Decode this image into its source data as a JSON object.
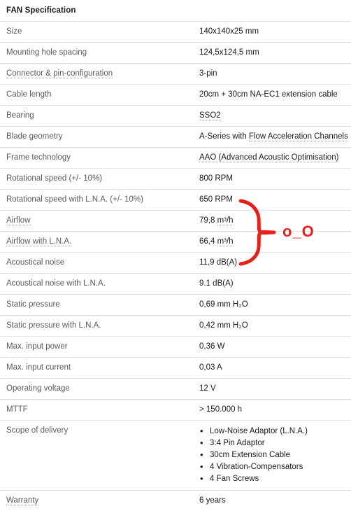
{
  "panel": {
    "title": "FAN Specification"
  },
  "rows": [
    {
      "label": "Size",
      "label_underline": "none",
      "value": "140x140x25 mm",
      "value_underline": "none"
    },
    {
      "label": "Mounting hole spacing",
      "label_underline": "none",
      "value": "124,5x124,5 mm",
      "value_underline": "none"
    },
    {
      "label": "Connector & pin-configuration",
      "label_underline": "dotted",
      "value": "3-pin",
      "value_underline": "none"
    },
    {
      "label": "Cable length",
      "label_underline": "none",
      "value": "20cm + 30cm NA-EC1 extension cable",
      "value_underline": "none"
    },
    {
      "label": "Bearing",
      "label_underline": "none",
      "value": "SSO2",
      "value_underline": "dotted"
    },
    {
      "label": "Blade geometry",
      "label_underline": "none",
      "value_prefix": "A-Series with ",
      "value_link": "Flow Acceleration Channels",
      "value_underline": "split"
    },
    {
      "label": "Frame technology",
      "label_underline": "none",
      "value": "AAO (Advanced Acoustic Optimisation)",
      "value_underline": "dotted"
    },
    {
      "label": "Rotational speed (+/- 10%)",
      "label_underline": "none",
      "value": "800 RPM",
      "value_underline": "none"
    },
    {
      "label": "Rotational speed with L.N.A. (+/- 10%)",
      "label_underline": "none",
      "value": "650 RPM",
      "value_underline": "none"
    },
    {
      "label": "Airflow",
      "label_underline": "dotted",
      "value_prefix": "79,8 ",
      "value_link": "m³/h",
      "value_underline": "split"
    },
    {
      "label": "Airflow with L.N.A.",
      "label_underline": "dotted",
      "value_prefix": "66,4 ",
      "value_link": "m³/h",
      "value_underline": "split"
    },
    {
      "label": "Acoustical noise",
      "label_underline": "none",
      "value": "11,9 dB(A)",
      "value_underline": "none"
    },
    {
      "label": "Acoustical noise with L.N.A.",
      "label_underline": "none",
      "value": "9.1 dB(A)",
      "value_underline": "none"
    },
    {
      "label": "Static pressure",
      "label_underline": "none",
      "value": "0,69 mm H₂O",
      "value_underline": "none"
    },
    {
      "label": "Static pressure with L.N.A.",
      "label_underline": "none",
      "value": "0,42 mm H₂O",
      "value_underline": "none"
    },
    {
      "label": "Max. input power",
      "label_underline": "none",
      "value": "0,36 W",
      "value_underline": "none"
    },
    {
      "label": "Max. input current",
      "label_underline": "none",
      "value": "0,03 A",
      "value_underline": "none"
    },
    {
      "label": "Operating voltage",
      "label_underline": "none",
      "value": "12 V",
      "value_underline": "none"
    },
    {
      "label": "MTTF",
      "label_underline": "none",
      "value": "> 150.000 h",
      "value_underline": "none"
    }
  ],
  "scope_row": {
    "label": "Scope of delivery",
    "items": [
      "Low-Noise Adaptor (L.N.A.)",
      "3:4 Pin Adaptor",
      "30cm Extension Cable",
      "4 Vibration-Compensators",
      "4 Fan Screws"
    ]
  },
  "warranty_row": {
    "label": "Warranty",
    "label_underline": "dotted",
    "value": "6 years"
  },
  "annotation": {
    "text": "o_O",
    "color": "#e8201a",
    "shape": "curly-brace",
    "spans_rows": [
      "Airflow",
      "Airflow with L.N.A.",
      "Acoustical noise",
      "Acoustical noise with L.N.A."
    ]
  }
}
